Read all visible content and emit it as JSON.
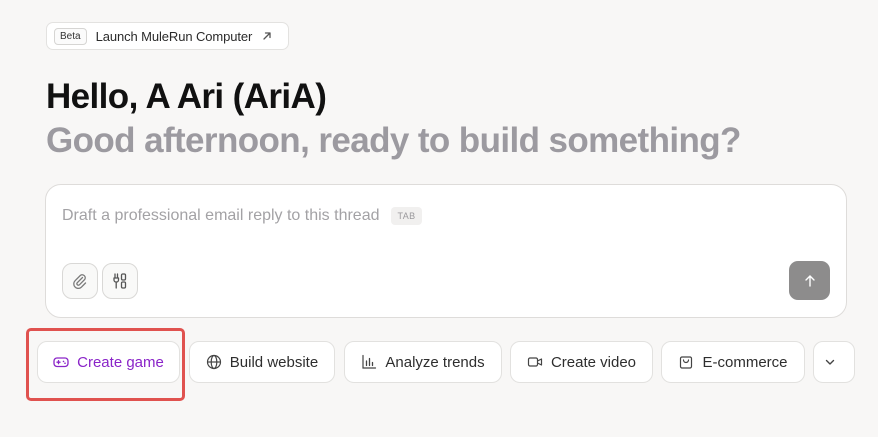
{
  "launch": {
    "badge": "Beta",
    "label": "Launch MuleRun Computer",
    "icon": "arrow-up-right-icon"
  },
  "greeting": "Hello, A Ari (AriA)",
  "subtitle": "Good afternoon, ready to build something?",
  "composer": {
    "placeholder": "Draft a professional email reply to this thread",
    "tab_hint": "TAB",
    "attach_icon": "paperclip-icon",
    "tools_icon": "tools-icon",
    "send_icon": "arrow-up-icon",
    "send_color": "#8d8c8c"
  },
  "chips": [
    {
      "label": "Create game",
      "icon": "gamepad-icon",
      "selected": true
    },
    {
      "label": "Build website",
      "icon": "globe-icon"
    },
    {
      "label": "Analyze trends",
      "icon": "bar-chart-icon"
    },
    {
      "label": "Create video",
      "icon": "video-icon"
    },
    {
      "label": "E-commerce",
      "icon": "shopping-bag-icon"
    }
  ],
  "more_icon": "chevron-down-icon",
  "colors": {
    "accent": "#8a24c8",
    "highlight": "#e0524f",
    "background": "#f8f7f6"
  }
}
